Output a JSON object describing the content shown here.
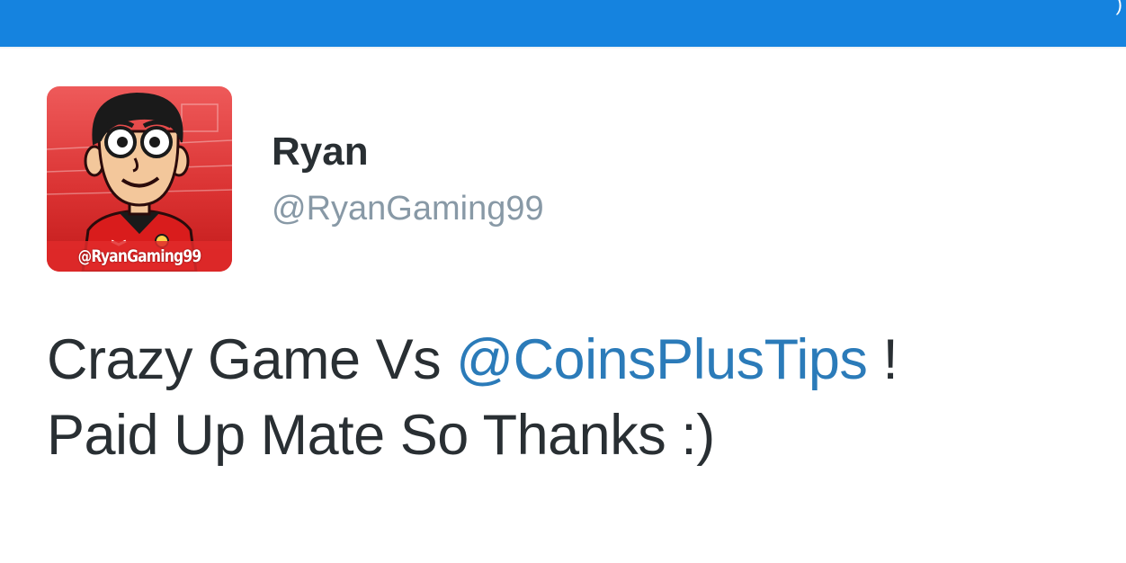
{
  "topbar": {
    "color": "#1583df",
    "corner_glyph": ")"
  },
  "tweet": {
    "author": {
      "display_name": "Ryan",
      "handle": "@RyanGaming99",
      "avatar_caption": "@RyanGaming99"
    },
    "text": {
      "line1_before": "Crazy Game Vs ",
      "mention": "@CoinsPlusTips",
      "line1_after": " !",
      "line2": "Paid Up Mate So Thanks :)"
    }
  },
  "colors": {
    "name": "#292f33",
    "handle": "#8899a6",
    "mention": "#2b7bb9",
    "avatar_bg": "#e02a2a"
  }
}
